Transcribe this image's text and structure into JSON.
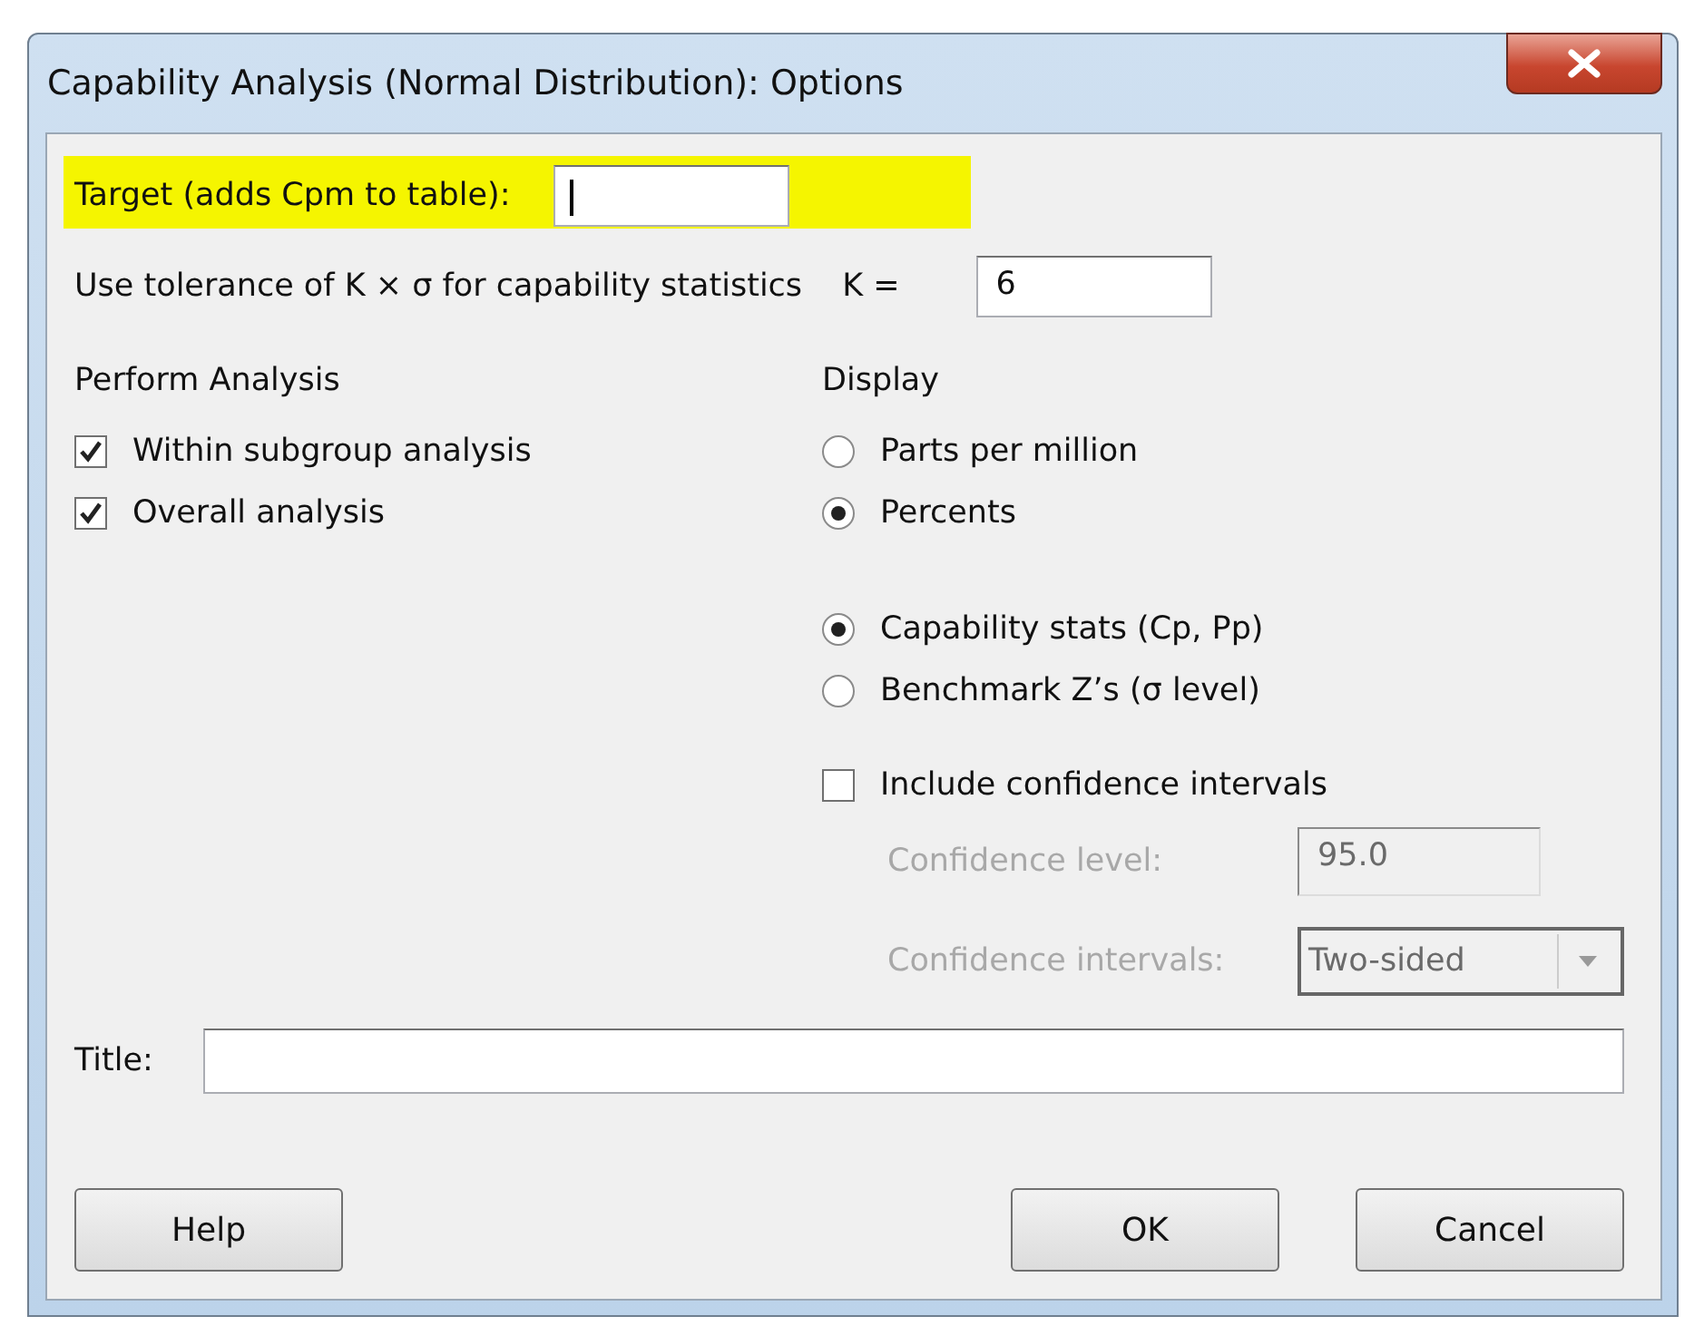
{
  "window": {
    "title": "Capability Analysis (Normal Distribution): Options"
  },
  "target": {
    "label": "Target (adds Cpm to table):",
    "highlighted": true
  },
  "tolerance": {
    "label": "Use tolerance of K × σ for capability statistics",
    "k_label": "K =",
    "value": "6"
  },
  "perform_analysis": {
    "heading": "Perform Analysis",
    "options": [
      {
        "label": "Within subgroup analysis",
        "checked": true
      },
      {
        "label": "Overall analysis",
        "checked": true
      }
    ]
  },
  "display": {
    "heading": "Display",
    "units": [
      {
        "label": "Parts per million",
        "selected": false
      },
      {
        "label": "Percents",
        "selected": true
      }
    ],
    "statistics": [
      {
        "label": "Capability stats (Cp, Pp)",
        "selected": true
      },
      {
        "label": "Benchmark Z’s (σ level)",
        "selected": false
      }
    ]
  },
  "confidence": {
    "label": "Include confidence intervals",
    "checked": false,
    "disabled": true,
    "level_label": "Confidence level:",
    "level_value": "95.0",
    "intervals_label": "Confidence intervals:",
    "intervals_value": "Two-sided"
  },
  "title_field": {
    "label": "Title:"
  },
  "buttons": [
    {
      "label": "Help",
      "kind": "left"
    },
    {
      "label": "OK",
      "kind": "right"
    },
    {
      "label": "Cancel",
      "kind": "right"
    }
  ]
}
